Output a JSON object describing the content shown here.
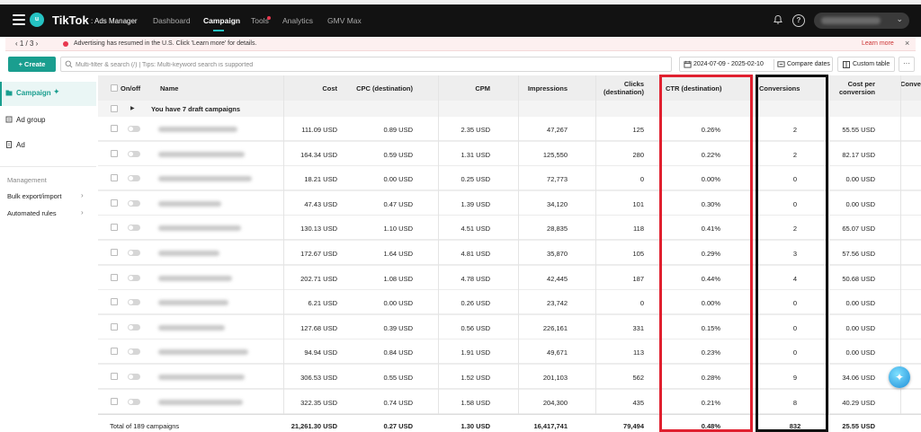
{
  "app": {
    "brand": "TikTok",
    "brand_sub": ": Ads Manager",
    "user_initial": "u",
    "nav": [
      "Dashboard",
      "Campaign",
      "Tools",
      "Analytics",
      "GMV Max"
    ],
    "active_nav": "Campaign"
  },
  "banner": {
    "pager": "‹ 1 / 3 ›",
    "message": "Advertising has resumed in the U.S. Click 'Learn more' for details.",
    "link": "Learn more",
    "close": "×"
  },
  "toolbar": {
    "create_label": "+ Create",
    "search_placeholder": "Multi-filter & search (/) | Tips: Multi-keyword search is supported",
    "date_range": "2024-07-09 - 2025-02-10",
    "compare_label": "Compare dates",
    "custom_table_label": "Custom table",
    "more_label": "···"
  },
  "sidebar": {
    "items": [
      {
        "label": "Campaign",
        "active": true
      },
      {
        "label": "Ad group",
        "active": false
      },
      {
        "label": "Ad",
        "active": false
      }
    ],
    "management_heading": "Management",
    "management_items": [
      "Bulk export/import",
      "Automated rules"
    ],
    "chevron": "›"
  },
  "table": {
    "headers": {
      "onoff": "On/off",
      "name": "Name",
      "cost": "Cost",
      "cpc": "CPC (destination)",
      "cpm": "CPM",
      "impressions": "Impressions",
      "clicks_1": "Clicks",
      "clicks_2": "(destination)",
      "ctr": "CTR (destination)",
      "conversions": "Conversions",
      "cpconv_1": "Cost per",
      "cpconv_2": "conversion",
      "conv_rate": "Conve"
    },
    "draft_caret": "▶",
    "draft_text": "You have 7 draft campaigns",
    "rows": [
      {
        "cost": "111.09 USD",
        "cpc": "0.89 USD",
        "cpm": "2.35 USD",
        "impressions": "47,267",
        "clicks": "125",
        "ctr": "0.26%",
        "conversions": "2",
        "cpconv": "55.55 USD"
      },
      {
        "cost": "164.34 USD",
        "cpc": "0.59 USD",
        "cpm": "1.31 USD",
        "impressions": "125,550",
        "clicks": "280",
        "ctr": "0.22%",
        "conversions": "2",
        "cpconv": "82.17 USD"
      },
      {
        "cost": "18.21 USD",
        "cpc": "0.00 USD",
        "cpm": "0.25 USD",
        "impressions": "72,773",
        "clicks": "0",
        "ctr": "0.00%",
        "conversions": "0",
        "cpconv": "0.00 USD"
      },
      {
        "cost": "47.43 USD",
        "cpc": "0.47 USD",
        "cpm": "1.39 USD",
        "impressions": "34,120",
        "clicks": "101",
        "ctr": "0.30%",
        "conversions": "0",
        "cpconv": "0.00 USD"
      },
      {
        "cost": "130.13 USD",
        "cpc": "1.10 USD",
        "cpm": "4.51 USD",
        "impressions": "28,835",
        "clicks": "118",
        "ctr": "0.41%",
        "conversions": "2",
        "cpconv": "65.07 USD"
      },
      {
        "cost": "172.67 USD",
        "cpc": "1.64 USD",
        "cpm": "4.81 USD",
        "impressions": "35,870",
        "clicks": "105",
        "ctr": "0.29%",
        "conversions": "3",
        "cpconv": "57.56 USD"
      },
      {
        "cost": "202.71 USD",
        "cpc": "1.08 USD",
        "cpm": "4.78 USD",
        "impressions": "42,445",
        "clicks": "187",
        "ctr": "0.44%",
        "conversions": "4",
        "cpconv": "50.68 USD"
      },
      {
        "cost": "6.21 USD",
        "cpc": "0.00 USD",
        "cpm": "0.26 USD",
        "impressions": "23,742",
        "clicks": "0",
        "ctr": "0.00%",
        "conversions": "0",
        "cpconv": "0.00 USD"
      },
      {
        "cost": "127.68 USD",
        "cpc": "0.39 USD",
        "cpm": "0.56 USD",
        "impressions": "226,161",
        "clicks": "331",
        "ctr": "0.15%",
        "conversions": "0",
        "cpconv": "0.00 USD"
      },
      {
        "cost": "94.94 USD",
        "cpc": "0.84 USD",
        "cpm": "1.91 USD",
        "impressions": "49,671",
        "clicks": "113",
        "ctr": "0.23%",
        "conversions": "0",
        "cpconv": "0.00 USD"
      },
      {
        "cost": "306.53 USD",
        "cpc": "0.55 USD",
        "cpm": "1.52 USD",
        "impressions": "201,103",
        "clicks": "562",
        "ctr": "0.28%",
        "conversions": "9",
        "cpconv": "34.06 USD"
      },
      {
        "cost": "322.35 USD",
        "cpc": "0.74 USD",
        "cpm": "1.58 USD",
        "impressions": "204,300",
        "clicks": "435",
        "ctr": "0.21%",
        "conversions": "8",
        "cpconv": "40.29 USD"
      }
    ],
    "total": {
      "label": "Total of 189 campaigns",
      "cost": "21,261.30 USD",
      "cpc": "0.27 USD",
      "cpm": "1.30 USD",
      "impressions": "16,417,741",
      "clicks": "79,494",
      "ctr": "0.48%",
      "conversions": "832",
      "cpconv": "25.55 USD"
    }
  },
  "colors": {
    "accent": "#1a9e8f",
    "highlight_red": "#e0202f",
    "highlight_black": "#111111"
  }
}
